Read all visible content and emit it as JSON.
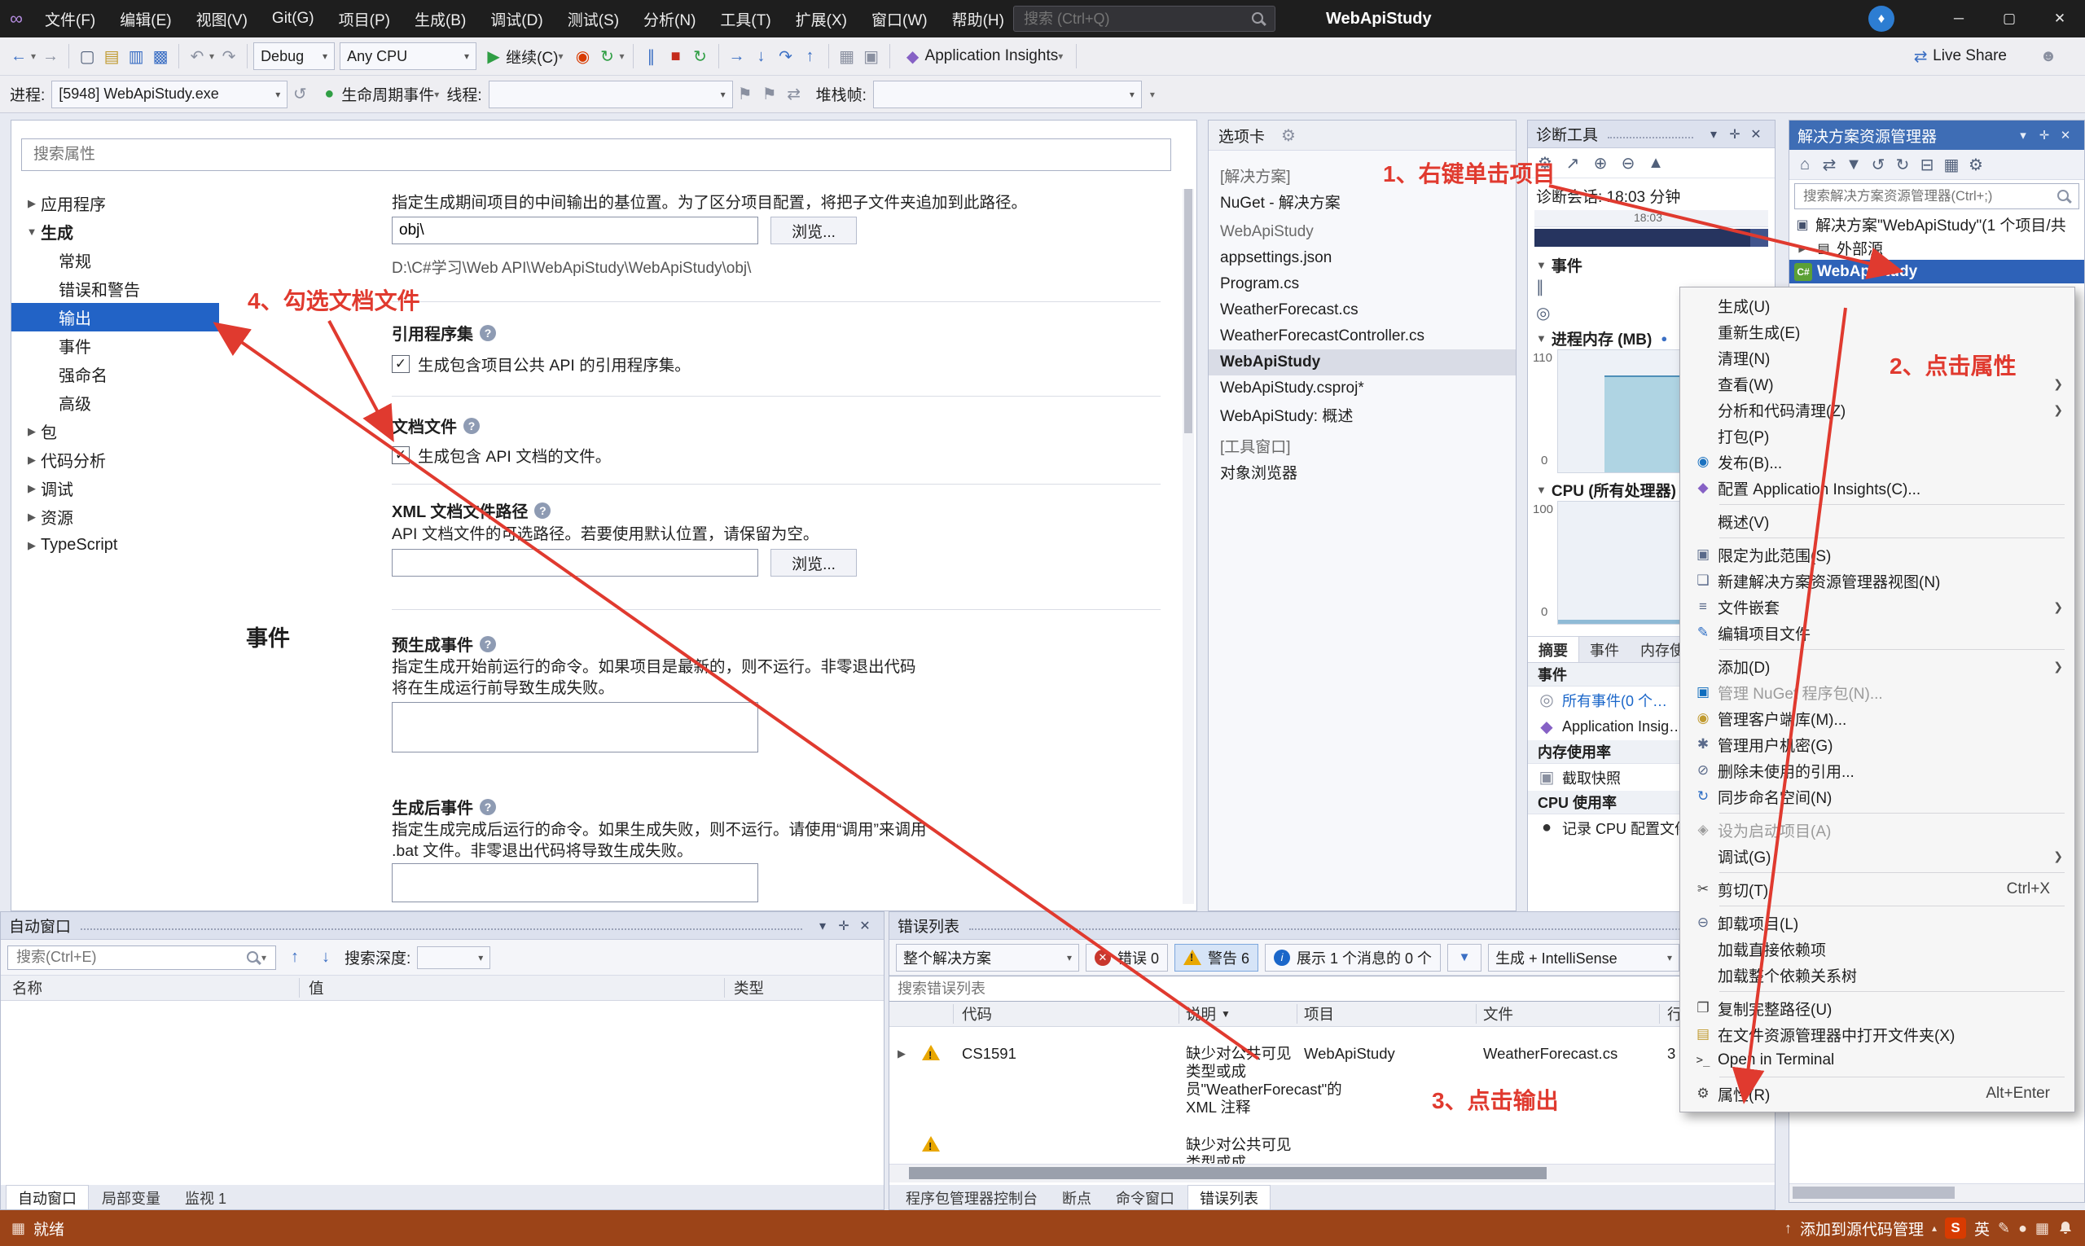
{
  "titlebar": {
    "menus": [
      "文件(F)",
      "编辑(E)",
      "视图(V)",
      "Git(G)",
      "项目(P)",
      "生成(B)",
      "调试(D)",
      "测试(S)",
      "分析(N)",
      "工具(T)",
      "扩展(X)",
      "窗口(W)",
      "帮助(H)"
    ],
    "search_placeholder": "搜索 (Ctrl+Q)",
    "app_title": "WebApiStudy"
  },
  "toolbar": {
    "config": "Debug",
    "platform": "Any CPU",
    "continue_label": "继续(C)",
    "app_insights": "Application Insights",
    "live_share": "Live Share"
  },
  "debugbar": {
    "process_label": "进程:",
    "process_value": "[5948] WebApiStudy.exe",
    "lifecycle_label": "生命周期事件",
    "thread_label": "线程:",
    "stack_label": "堆栈帧:"
  },
  "props": {
    "search_placeholder": "搜索属性",
    "nav": [
      "应用程序",
      "生成",
      "常规",
      "错误和警告",
      "输出",
      "事件",
      "强命名",
      "高级",
      "包",
      "代码分析",
      "调试",
      "资源",
      "TypeScript"
    ],
    "base_output_desc": "指定生成期间项目的中间输出的基位置。为了区分项目配置，将把子文件夹追加到此路径。",
    "base_output_value": "obj\\",
    "browse": "浏览...",
    "base_output_path": "D:\\C#学习\\Web API\\WebApiStudy\\WebApiStudy\\obj\\",
    "ref_assembly_title": "引用程序集",
    "ref_assembly_check": "生成包含项目公共 API 的引用程序集。",
    "doc_file_title": "文档文件",
    "doc_file_check": "生成包含 API 文档的文件。",
    "xml_path_title": "XML 文档文件路径",
    "xml_path_desc": "API 文档文件的可选路径。若要使用默认位置，请保留为空。",
    "events_title": "事件",
    "prebuild_title": "预生成事件",
    "prebuild_desc": "指定生成开始前运行的命令。如果项目是最新的，则不运行。非零退出代码将在生成运行前导致生成失败。",
    "postbuild_title": "生成后事件",
    "postbuild_desc": "指定生成完成后运行的命令。如果生成失败，则不运行。请使用“调用”来调用 .bat 文件。非零退出代码将导致生成失败。"
  },
  "tabswell": {
    "title": "选项卡",
    "rows": [
      {
        "label": "[解决方案]"
      },
      {
        "label": "NuGet - 解决方案"
      },
      {
        "label": "WebApiStudy"
      },
      {
        "label": "appsettings.json"
      },
      {
        "label": "Program.cs"
      },
      {
        "label": "WeatherForecast.cs"
      },
      {
        "label": "WeatherForecastController.cs"
      },
      {
        "label": "WebApiStudy"
      },
      {
        "label": "WebApiStudy.csproj*"
      },
      {
        "label": "WebApiStudy: 概述"
      },
      {
        "label": "[工具窗口]"
      },
      {
        "label": "对象浏览器"
      }
    ]
  },
  "diag": {
    "title": "诊断工具",
    "session": "诊断会话: 18:03 分钟",
    "tick": "18:03",
    "events_section": "事件",
    "mem_section": "进程内存 (MB)",
    "mem_top": "110",
    "mem_bottom": "0",
    "cpu_section": "CPU (所有处理器)",
    "cpu_top": "100",
    "cpu_bottom": "0",
    "tabs": [
      "摘要",
      "事件",
      "内存使用率"
    ],
    "sum_events": "事件",
    "all_events": "所有事件(0 个…",
    "app_insights": "Application Insig…",
    "sum_mem": "内存使用率",
    "snapshot": "截取快照",
    "sum_cpu": "CPU 使用率",
    "record_cpu": "记录 CPU 配置文件…"
  },
  "solution": {
    "title": "解决方案资源管理器",
    "search_placeholder": "搜索解决方案资源管理器(Ctrl+;)",
    "root": "解决方案\"WebApiStudy\"(1 个项目/共",
    "external": "外部源",
    "project": "WebApiStudy"
  },
  "menu": {
    "items": [
      {
        "label": "生成(U)"
      },
      {
        "label": "重新生成(E)"
      },
      {
        "label": "清理(N)"
      },
      {
        "label": "查看(W)"
      },
      {
        "label": "分析和代码清理(Z)"
      },
      {
        "label": "打包(P)"
      },
      {
        "label": "发布(B)..."
      },
      {
        "label": "配置 Application Insights(C)..."
      },
      {
        "label": "概述(V)"
      },
      {
        "label": "限定为此范围(S)"
      },
      {
        "label": "新建解决方案资源管理器视图(N)"
      },
      {
        "label": "文件嵌套"
      },
      {
        "label": "编辑项目文件"
      },
      {
        "label": "添加(D)"
      },
      {
        "label": "管理 NuGet 程序包(N)..."
      },
      {
        "label": "管理客户端库(M)..."
      },
      {
        "label": "管理用户机密(G)"
      },
      {
        "label": "删除未使用的引用..."
      },
      {
        "label": "同步命名空间(N)"
      },
      {
        "label": "设为启动项目(A)"
      },
      {
        "label": "调试(G)"
      },
      {
        "label": "剪切(T)",
        "shortcut": "Ctrl+X"
      },
      {
        "label": "卸载项目(L)"
      },
      {
        "label": "加载直接依赖项"
      },
      {
        "label": "加载整个依赖关系树"
      },
      {
        "label": "复制完整路径(U)"
      },
      {
        "label": "在文件资源管理器中打开文件夹(X)"
      },
      {
        "label": "Open in Terminal"
      },
      {
        "label": "属性(R)",
        "shortcut": "Alt+Enter"
      }
    ]
  },
  "autos": {
    "title": "自动窗口",
    "search_placeholder": "搜索(Ctrl+E)",
    "depth_label": "搜索深度:",
    "columns": [
      "名称",
      "值",
      "类型"
    ],
    "tabs": [
      "自动窗口",
      "局部变量",
      "监视 1"
    ]
  },
  "errorlist": {
    "title": "错误列表",
    "scope": "整个解决方案",
    "errors_label": "错误 0",
    "warnings_label": "警告 6",
    "messages_label": "展示 1 个消息的 0 个",
    "filter_source": "生成 + IntelliSense",
    "search_placeholder": "搜索错误列表",
    "columns": [
      "代码",
      "说明",
      "项目",
      "文件",
      "行"
    ],
    "rows": [
      {
        "code": "CS1591",
        "desc": "缺少对公共可见类型或成员\"WeatherForecast\"的 XML 注释",
        "project": "WebApiStudy",
        "file": "WeatherForecast.cs",
        "line": "3"
      },
      {
        "code": "",
        "desc": "缺少对公共可见类型或成员\"WeatherF",
        "project": "",
        "file": "",
        "line": ""
      }
    ],
    "tabs": [
      "程序包管理器控制台",
      "断点",
      "命令窗口",
      "错误列表"
    ]
  },
  "statusbar": {
    "ready": "就绪",
    "source_control": "添加到源代码管理",
    "ime": "英"
  },
  "annotations": {
    "n1": "1、右键单击项目",
    "n2": "2、点击属性",
    "n3": "3、点击输出",
    "n4": "4、勾选文档文件"
  },
  "colors": {
    "accent": "#2263C6",
    "annotation": "#E03A2F",
    "warning": "#E9A700",
    "error": "#C8372D",
    "statusbar": "#9C4418"
  },
  "icons": {
    "back": "←",
    "forward": "→",
    "new_file": "▢",
    "open_folder": "▤",
    "save": "▥",
    "save_all": "▩",
    "undo": "↶",
    "redo": "↷",
    "play": "▶",
    "pause": "∥",
    "stop": "■",
    "restart": "↻",
    "step_into": "↓",
    "step_over": "↷",
    "step_out": "↑",
    "flame": "◉",
    "diamond": "◆",
    "swap": "⇄",
    "person": "☻",
    "gear": "⚙",
    "zoom_in": "⊕",
    "zoom_out": "⊖",
    "chart": "▲",
    "export": "↗",
    "home": "⌂",
    "funnel": "▼",
    "sync": "↺",
    "refresh": "↻",
    "collapse": "⊟",
    "grid": "▦",
    "pin": "✛",
    "close": "✕",
    "chevron_down": "▾",
    "tri_right": "▶",
    "tri_down": "▼",
    "square": "▣",
    "cut": "✂",
    "copy": "❐",
    "edit": "✎",
    "terminal": ">_",
    "link": "◎",
    "record": "●",
    "up": "↑",
    "caret_up": "▴",
    "flag": "⚑",
    "scope": "▣",
    "new_view": "❏",
    "nest": "≡",
    "secret": "✱",
    "remove_ref": "⊘",
    "startup": "◈",
    "unload": "⊖",
    "camera": "▣"
  }
}
